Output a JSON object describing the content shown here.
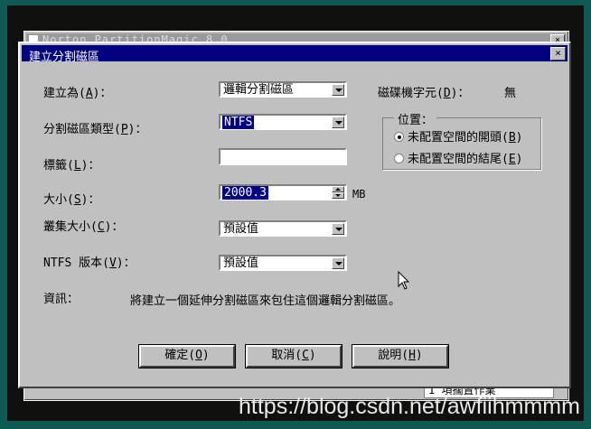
{
  "background_window": {
    "title": "Norton PartitionMagic 8.0",
    "status_text": "1 項擱置作業"
  },
  "dialog": {
    "title": "建立分割磁區",
    "close_label": "×",
    "create_as": {
      "label_pre": "建立為(",
      "key": "A",
      "label_post": ")：",
      "value": "邏輯分割磁區"
    },
    "drive_letter": {
      "label_pre": "磁碟機字元(",
      "key": "D",
      "label_post": ")：",
      "value": "無"
    },
    "partition_type": {
      "label_pre": "分割磁區類型(",
      "key": "P",
      "label_post": ")：",
      "value": "NTFS"
    },
    "volume_label": {
      "label_pre": "標籤(",
      "key": "L",
      "label_post": ")：",
      "value": ""
    },
    "size": {
      "label_pre": "大小(",
      "key": "S",
      "label_post": ")：",
      "value": "2000.3",
      "unit": "MB"
    },
    "cluster_size": {
      "label_pre": "叢集大小(",
      "key": "C",
      "label_post": ")：",
      "value": "預設值"
    },
    "ntfs_version": {
      "label_pre": "NTFS 版本(",
      "key": "V",
      "label_post": ")：",
      "value": "預設值"
    },
    "position": {
      "legend": "位置：",
      "options": [
        {
          "label_pre": "未配置空間的開頭(",
          "key": "B",
          "label_post": ")",
          "selected": true
        },
        {
          "label_pre": "未配置空間的結尾(",
          "key": "E",
          "label_post": ")",
          "selected": false
        }
      ]
    },
    "info": {
      "label": "資訊：",
      "text": "將建立一個延伸分割磁區來包住這個邏輯分割磁區。"
    },
    "buttons": {
      "ok": {
        "label_pre": "確定(",
        "key": "O",
        "label_post": ")"
      },
      "cancel": {
        "label_pre": "取消(",
        "key": "C",
        "label_post": ")"
      },
      "help": {
        "label_pre": "說明(",
        "key": "H",
        "label_post": ")"
      }
    }
  },
  "watermark": "https://blog.csdn.net/awfiihmmmm",
  "colors": {
    "desktop": "#0f5a52",
    "title_bar": "#000080",
    "face": "#c0c0c0",
    "selection": "#000080"
  }
}
